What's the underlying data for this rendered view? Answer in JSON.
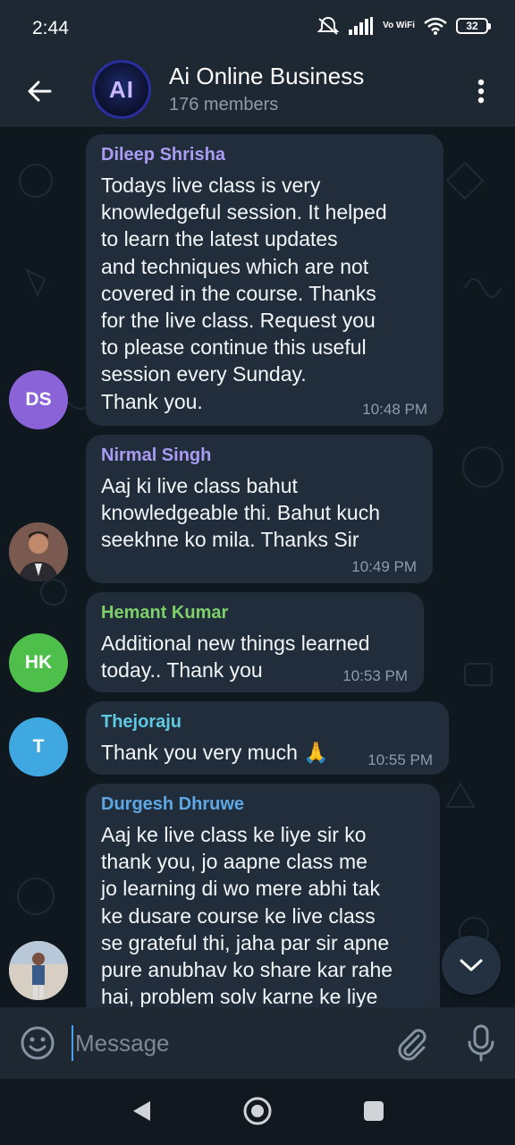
{
  "status_bar": {
    "time": "2:44",
    "network": "Vo WiFi",
    "battery": "32"
  },
  "header": {
    "title": "Ai Online Business",
    "subtitle": "176 members",
    "avatar_text": "AI"
  },
  "messages": [
    {
      "sender": "Dileep Shrisha",
      "sender_color": "#a99cf2",
      "text": "Todays live class is very\nknowledgeful session. It helped\nto learn the latest updates\nand techniques which are not\ncovered in the course. Thanks\nfor the live class. Request you\nto please continue this useful\nsession every Sunday.\nThank you.",
      "time": "10:48 PM",
      "avatar_initials": "DS",
      "avatar_color": "#8b63d9"
    },
    {
      "sender": "Nirmal Singh",
      "sender_color": "#a99cf2",
      "text": "Aaj ki live class bahut\nknowledgeable thi. Bahut kuch\nseekhne ko mila. Thanks Sir",
      "time": "10:49 PM",
      "avatar_initials": "",
      "avatar_color": "#5a4a45"
    },
    {
      "sender": "Hemant Kumar",
      "sender_color": "#7ed06a",
      "text": "Additional new things learned\ntoday.. Thank you",
      "time": "10:53 PM",
      "avatar_initials": "HK",
      "avatar_color": "#4dbf4a"
    },
    {
      "sender": "Thejoraju",
      "sender_color": "#5ec9e0",
      "text": "Thank you very much 🙏",
      "time": "10:55 PM",
      "avatar_initials": "T",
      "avatar_color": "#3fa8e0"
    },
    {
      "sender": "Durgesh Dhruwe",
      "sender_color": "#5ea8e6",
      "text": "Aaj ke live  class ke liye sir ko\nthank you, jo aapne class me\njo learning di wo mere abhi tak\nke dusare course ke live class\nse grateful thi, jaha par sir apne\npure anubhav ko share kar rahe\nhai, problem solv karne ke liye",
      "time": "",
      "avatar_initials": "",
      "avatar_color": "#c9b8a8"
    }
  ],
  "input": {
    "placeholder": "Message"
  },
  "icons": {
    "back": "arrow-left-icon",
    "menu": "more-vertical-icon",
    "emoji": "smile-icon",
    "attach": "paperclip-icon",
    "mic": "microphone-icon",
    "scroll": "chevron-down-icon"
  }
}
